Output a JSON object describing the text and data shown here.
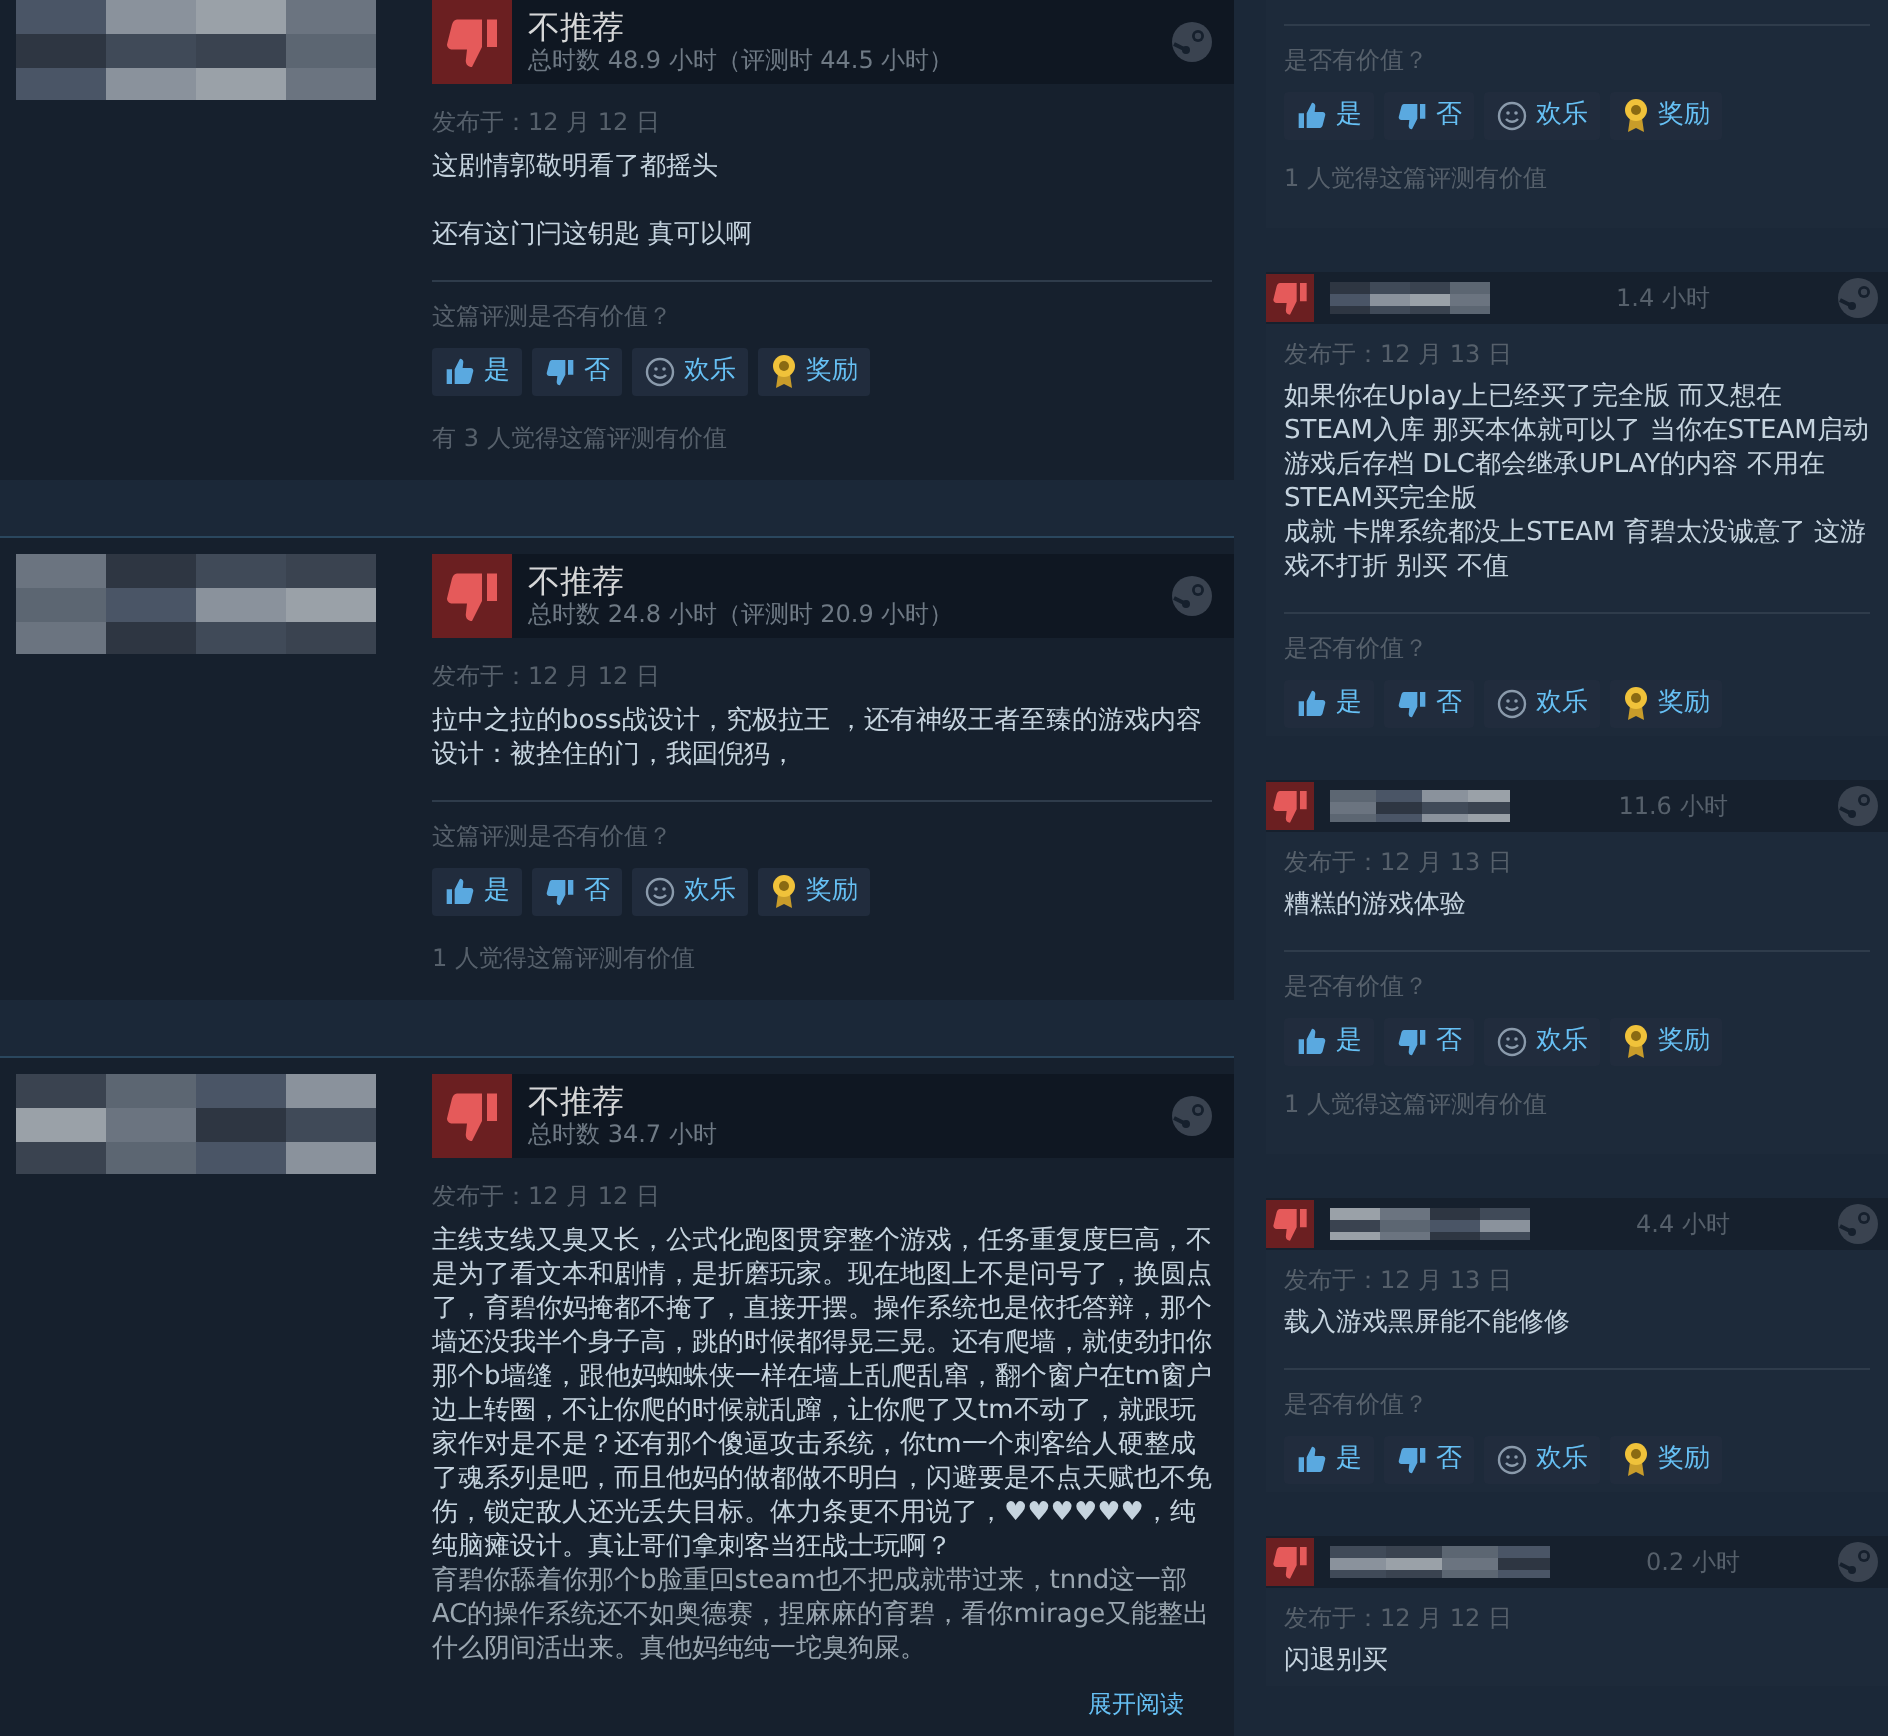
{
  "left_reviews": [
    {
      "recommended": false,
      "verdict": "不推荐",
      "hours": "总时数 48.9 小时（评测时 44.5 小时）",
      "posted": "发布于：12 月 12 日",
      "body": [
        "这剧情郭敬明看了都摇头",
        "还有这门闩这钥匙 真可以啊"
      ],
      "paragraph_gap": true,
      "helpful_prompt": "这篇评测是否有价值？",
      "buttons": [
        {
          "kind": "yes",
          "label": "是"
        },
        {
          "kind": "no",
          "label": "否"
        },
        {
          "kind": "funny",
          "label": "欢乐"
        },
        {
          "kind": "award",
          "label": "奖励"
        }
      ],
      "helpful_count": "有 3 人觉得这篇评测有价值"
    },
    {
      "recommended": false,
      "verdict": "不推荐",
      "hours": "总时数 24.8 小时（评测时 20.9 小时）",
      "posted": "发布于：12 月 12 日",
      "body": [
        "拉中之拉的boss战设计，究极拉王 ，还有神级王者至臻的游戏内容设计：被拴住的门，我囸倪犸，"
      ],
      "helpful_prompt": "这篇评测是否有价值？",
      "buttons": [
        {
          "kind": "yes",
          "label": "是"
        },
        {
          "kind": "no",
          "label": "否"
        },
        {
          "kind": "funny",
          "label": "欢乐"
        },
        {
          "kind": "award",
          "label": "奖励"
        }
      ],
      "helpful_count": "1 人觉得这篇评测有价值"
    },
    {
      "recommended": false,
      "verdict": "不推荐",
      "hours": "总时数 34.7 小时",
      "posted": "发布于：12 月 12 日",
      "body": [
        "主线支线又臭又长，公式化跑图贯穿整个游戏，任务重复度巨高，不是为了看文本和剧情，是折磨玩家。现在地图上不是问号了，换圆点了，育碧你妈掩都不掩了，直接开摆。操作系统也是依托答辩，那个墙还没我半个身子高，跳的时候都得晃三晃。还有爬墙，就使劲扣你那个b墙缝，跟他妈蜘蛛侠一样在墙上乱爬乱窜，翻个窗户在tm窗户边上转圈，不让你爬的时候就乱蹿，让你爬了又tm不动了，就跟玩家作对是不是？还有那个傻逼攻击系统，你tm一个刺客给人硬整成了魂系列是吧，而且他妈的做都做不明白，闪避要是不点天赋也不免伤，锁定敌人还光丢失目标。体力条更不用说了，♥♥♥♥♥♥，纯纯脑瘫设计。真让哥们拿刺客当狂战士玩啊？",
        "育碧你舔着你那个b脸重回steam也不把成就带过来，tnnd这一部AC的操作系统还不如奥德赛，捏麻麻的育碧，看你mirage又能整出什么阴间活出来。真他妈纯纯一坨臭狗屎。"
      ],
      "paragraph_gap": false,
      "truncated": true,
      "expand_link": "展开阅读"
    }
  ],
  "right_reviews": [
    {
      "helpful_prompt": "是否有价值？",
      "buttons": [
        {
          "kind": "yes",
          "label": "是"
        },
        {
          "kind": "no",
          "label": "否"
        },
        {
          "kind": "funny",
          "label": "欢乐"
        },
        {
          "kind": "award",
          "label": "奖励"
        }
      ],
      "helpful_count": "1 人觉得这篇评测有价值"
    },
    {
      "recommended": false,
      "hours": "1.4 小时",
      "posted": "发布于：12 月 13 日",
      "body": [
        "如果你在Uplay上已经买了完全版 而又想在STEAM入库 那买本体就可以了 当你在STEAM启动游戏后存档 DLC都会继承UPLAY的内容 不用在STEAM买完全版",
        "成就 卡牌系统都没上STEAM 育碧太没诚意了 这游戏不打折 别买 不值"
      ],
      "helpful_prompt": "是否有价值？",
      "buttons": [
        {
          "kind": "yes",
          "label": "是"
        },
        {
          "kind": "no",
          "label": "否"
        },
        {
          "kind": "funny",
          "label": "欢乐"
        },
        {
          "kind": "award",
          "label": "奖励"
        }
      ]
    },
    {
      "recommended": false,
      "hours": "11.6 小时",
      "posted": "发布于：12 月 13 日",
      "body": [
        "糟糕的游戏体验"
      ],
      "helpful_prompt": "是否有价值？",
      "buttons": [
        {
          "kind": "yes",
          "label": "是"
        },
        {
          "kind": "no",
          "label": "否"
        },
        {
          "kind": "funny",
          "label": "欢乐"
        },
        {
          "kind": "award",
          "label": "奖励"
        }
      ],
      "helpful_count": "1 人觉得这篇评测有价值"
    },
    {
      "recommended": false,
      "hours": "4.4 小时",
      "posted": "发布于：12 月 13 日",
      "body": [
        "载入游戏黑屏能不能修修"
      ],
      "helpful_prompt": "是否有价值？",
      "buttons": [
        {
          "kind": "yes",
          "label": "是"
        },
        {
          "kind": "no",
          "label": "否"
        },
        {
          "kind": "funny",
          "label": "欢乐"
        },
        {
          "kind": "award",
          "label": "奖励"
        }
      ]
    },
    {
      "recommended": false,
      "hours": "0.2 小时",
      "posted": "发布于：12 月 12 日",
      "body": [
        "闪退别买"
      ]
    }
  ]
}
